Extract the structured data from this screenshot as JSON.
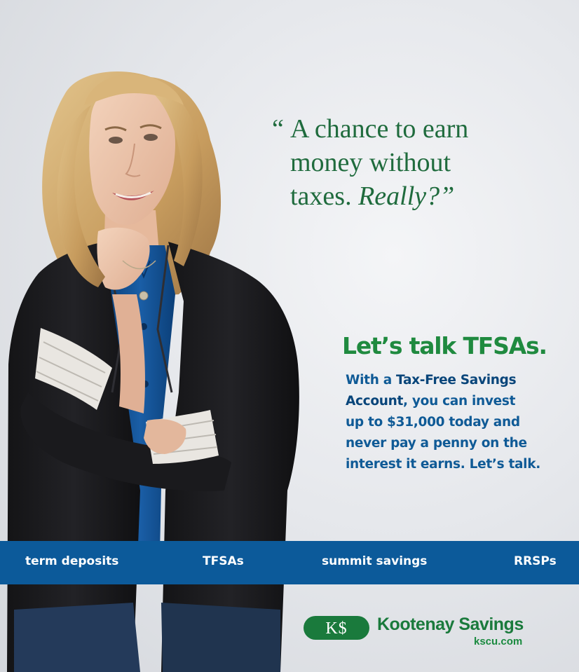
{
  "quote": {
    "open_mark": "“",
    "line1": "A chance to earn",
    "line2": "money without",
    "line3_plain": "taxes. ",
    "line3_italic": "Really?”"
  },
  "headline": "Let’s talk TFSAs.",
  "body": {
    "line1_prefix": "With a ",
    "line1_emphasis": "Tax-Free Savings",
    "line2_emphasis": "Account",
    "line2_rest": ", you can invest",
    "line3": "up to $31,000 today and",
    "line4": "never pay a penny on the",
    "line5": "interest it earns. Let’s talk."
  },
  "nav": {
    "items": [
      "term deposits",
      "TFSAs",
      "summit savings",
      "RRSPs"
    ]
  },
  "brand": {
    "logo_text": "K$",
    "name": "Kootenay Savings",
    "url": "kscu.com"
  },
  "colors": {
    "green": "#1f8a3f",
    "dark_green": "#1a7a3c",
    "blue": "#0f5a96",
    "nav_blue": "#0c5a9a",
    "background": "#e6e8ec"
  }
}
